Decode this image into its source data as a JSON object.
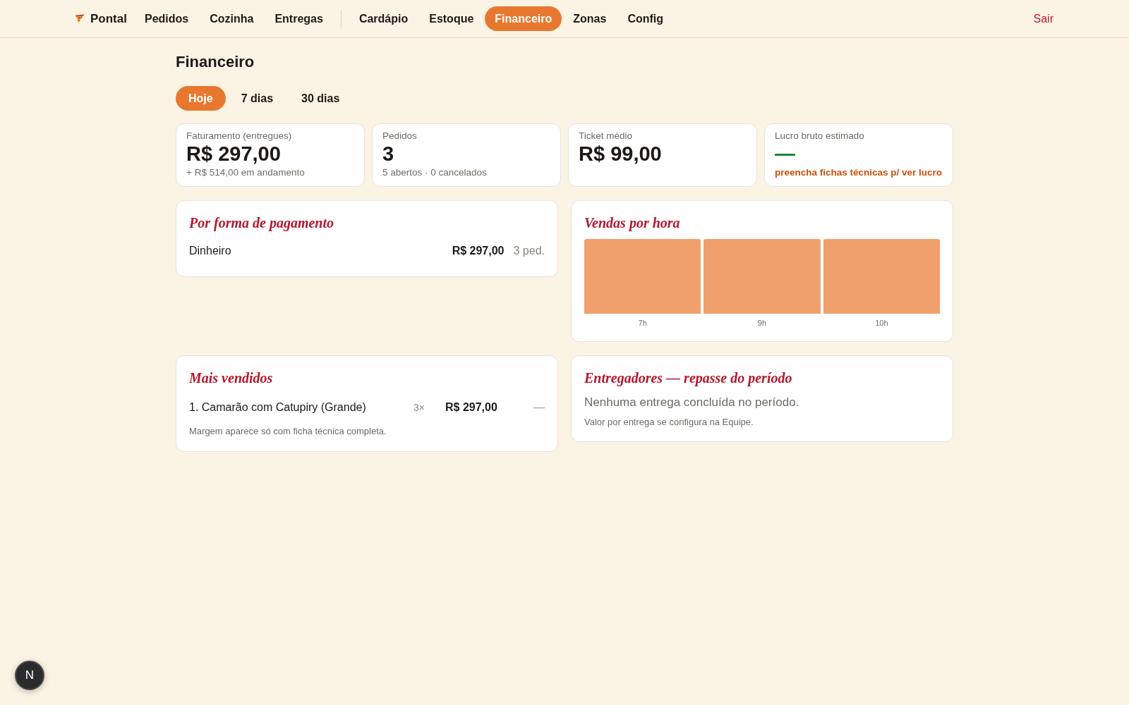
{
  "nav": {
    "brand": "Pontal",
    "groups": [
      {
        "items": [
          {
            "label": "Pedidos",
            "selected": false
          },
          {
            "label": "Cozinha",
            "selected": false
          },
          {
            "label": "Entregas",
            "selected": false
          }
        ]
      },
      {
        "items": [
          {
            "label": "Cardápio",
            "selected": false
          },
          {
            "label": "Estoque",
            "selected": false
          },
          {
            "label": "Financeiro",
            "selected": true
          },
          {
            "label": "Zonas",
            "selected": false
          },
          {
            "label": "Config",
            "selected": false
          }
        ]
      }
    ],
    "logout": "Sair"
  },
  "page_title": "Financeiro",
  "period_tabs": [
    {
      "label": "Hoje",
      "selected": true
    },
    {
      "label": "7 dias",
      "selected": false
    },
    {
      "label": "30 dias",
      "selected": false
    }
  ],
  "stats": [
    {
      "kind": "metric",
      "label": "Faturamento (entregues)",
      "value": "R$ 297,00",
      "note": "+ R$ 514,00 em andamento"
    },
    {
      "kind": "metric",
      "label": "Pedidos",
      "value": "3",
      "note": "5 abertos · 0 cancelados"
    },
    {
      "kind": "metric",
      "label": "Ticket médio",
      "value": "R$ 99,00"
    },
    {
      "kind": "estimate",
      "label": "Lucro bruto estimado",
      "value": "—",
      "note": "preencha fichas técnicas p/ ver lucro"
    }
  ],
  "payment_methods": {
    "title": "Por forma de pagamento",
    "rows": [
      {
        "method": "Dinheiro",
        "amount": "R$ 297,00",
        "orders": "3 ped."
      }
    ]
  },
  "sales_by_hour": {
    "title": "Vendas por hora",
    "hours": [
      "7h",
      "9h",
      "10h"
    ]
  },
  "top_sellers": {
    "title": "Mais vendidos",
    "rows": [
      {
        "item": "1. Camarão com Catupiry (Grande)",
        "quantity": "3×",
        "revenue": "R$ 297,00",
        "margin": "—"
      }
    ],
    "note": "Margem aparece só com ficha técnica completa."
  },
  "couriers": {
    "title": "Entregadores — repasse do período",
    "empty_message": "Nenhuma entrega concluída no período.",
    "note": "Valor por entrega se configura na Equipe."
  },
  "dev_badge": {
    "label": "N"
  }
}
